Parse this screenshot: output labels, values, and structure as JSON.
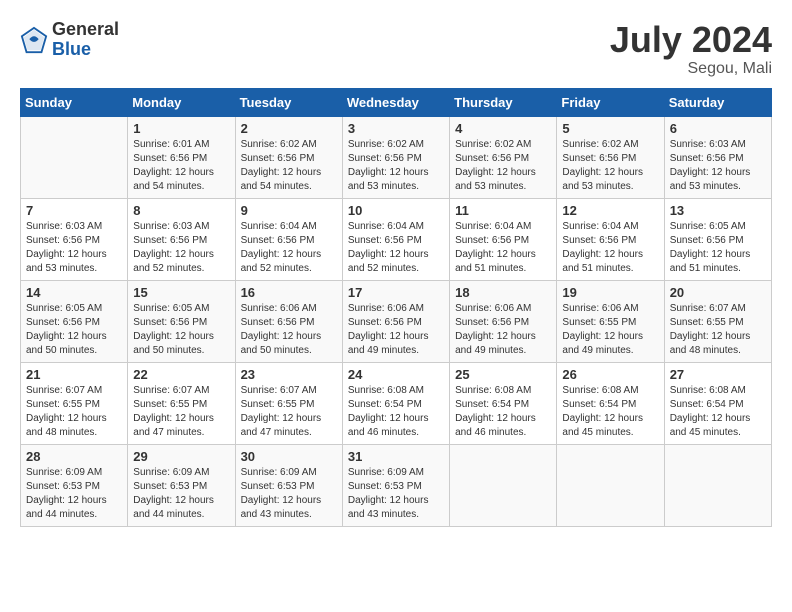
{
  "header": {
    "logo_general": "General",
    "logo_blue": "Blue",
    "month_year": "July 2024",
    "location": "Segou, Mali"
  },
  "columns": [
    "Sunday",
    "Monday",
    "Tuesday",
    "Wednesday",
    "Thursday",
    "Friday",
    "Saturday"
  ],
  "weeks": [
    [
      {
        "day": "",
        "info": ""
      },
      {
        "day": "1",
        "info": "Sunrise: 6:01 AM\nSunset: 6:56 PM\nDaylight: 12 hours\nand 54 minutes."
      },
      {
        "day": "2",
        "info": "Sunrise: 6:02 AM\nSunset: 6:56 PM\nDaylight: 12 hours\nand 54 minutes."
      },
      {
        "day": "3",
        "info": "Sunrise: 6:02 AM\nSunset: 6:56 PM\nDaylight: 12 hours\nand 53 minutes."
      },
      {
        "day": "4",
        "info": "Sunrise: 6:02 AM\nSunset: 6:56 PM\nDaylight: 12 hours\nand 53 minutes."
      },
      {
        "day": "5",
        "info": "Sunrise: 6:02 AM\nSunset: 6:56 PM\nDaylight: 12 hours\nand 53 minutes."
      },
      {
        "day": "6",
        "info": "Sunrise: 6:03 AM\nSunset: 6:56 PM\nDaylight: 12 hours\nand 53 minutes."
      }
    ],
    [
      {
        "day": "7",
        "info": "Sunrise: 6:03 AM\nSunset: 6:56 PM\nDaylight: 12 hours\nand 53 minutes."
      },
      {
        "day": "8",
        "info": "Sunrise: 6:03 AM\nSunset: 6:56 PM\nDaylight: 12 hours\nand 52 minutes."
      },
      {
        "day": "9",
        "info": "Sunrise: 6:04 AM\nSunset: 6:56 PM\nDaylight: 12 hours\nand 52 minutes."
      },
      {
        "day": "10",
        "info": "Sunrise: 6:04 AM\nSunset: 6:56 PM\nDaylight: 12 hours\nand 52 minutes."
      },
      {
        "day": "11",
        "info": "Sunrise: 6:04 AM\nSunset: 6:56 PM\nDaylight: 12 hours\nand 51 minutes."
      },
      {
        "day": "12",
        "info": "Sunrise: 6:04 AM\nSunset: 6:56 PM\nDaylight: 12 hours\nand 51 minutes."
      },
      {
        "day": "13",
        "info": "Sunrise: 6:05 AM\nSunset: 6:56 PM\nDaylight: 12 hours\nand 51 minutes."
      }
    ],
    [
      {
        "day": "14",
        "info": "Sunrise: 6:05 AM\nSunset: 6:56 PM\nDaylight: 12 hours\nand 50 minutes."
      },
      {
        "day": "15",
        "info": "Sunrise: 6:05 AM\nSunset: 6:56 PM\nDaylight: 12 hours\nand 50 minutes."
      },
      {
        "day": "16",
        "info": "Sunrise: 6:06 AM\nSunset: 6:56 PM\nDaylight: 12 hours\nand 50 minutes."
      },
      {
        "day": "17",
        "info": "Sunrise: 6:06 AM\nSunset: 6:56 PM\nDaylight: 12 hours\nand 49 minutes."
      },
      {
        "day": "18",
        "info": "Sunrise: 6:06 AM\nSunset: 6:56 PM\nDaylight: 12 hours\nand 49 minutes."
      },
      {
        "day": "19",
        "info": "Sunrise: 6:06 AM\nSunset: 6:55 PM\nDaylight: 12 hours\nand 49 minutes."
      },
      {
        "day": "20",
        "info": "Sunrise: 6:07 AM\nSunset: 6:55 PM\nDaylight: 12 hours\nand 48 minutes."
      }
    ],
    [
      {
        "day": "21",
        "info": "Sunrise: 6:07 AM\nSunset: 6:55 PM\nDaylight: 12 hours\nand 48 minutes."
      },
      {
        "day": "22",
        "info": "Sunrise: 6:07 AM\nSunset: 6:55 PM\nDaylight: 12 hours\nand 47 minutes."
      },
      {
        "day": "23",
        "info": "Sunrise: 6:07 AM\nSunset: 6:55 PM\nDaylight: 12 hours\nand 47 minutes."
      },
      {
        "day": "24",
        "info": "Sunrise: 6:08 AM\nSunset: 6:54 PM\nDaylight: 12 hours\nand 46 minutes."
      },
      {
        "day": "25",
        "info": "Sunrise: 6:08 AM\nSunset: 6:54 PM\nDaylight: 12 hours\nand 46 minutes."
      },
      {
        "day": "26",
        "info": "Sunrise: 6:08 AM\nSunset: 6:54 PM\nDaylight: 12 hours\nand 45 minutes."
      },
      {
        "day": "27",
        "info": "Sunrise: 6:08 AM\nSunset: 6:54 PM\nDaylight: 12 hours\nand 45 minutes."
      }
    ],
    [
      {
        "day": "28",
        "info": "Sunrise: 6:09 AM\nSunset: 6:53 PM\nDaylight: 12 hours\nand 44 minutes."
      },
      {
        "day": "29",
        "info": "Sunrise: 6:09 AM\nSunset: 6:53 PM\nDaylight: 12 hours\nand 44 minutes."
      },
      {
        "day": "30",
        "info": "Sunrise: 6:09 AM\nSunset: 6:53 PM\nDaylight: 12 hours\nand 43 minutes."
      },
      {
        "day": "31",
        "info": "Sunrise: 6:09 AM\nSunset: 6:53 PM\nDaylight: 12 hours\nand 43 minutes."
      },
      {
        "day": "",
        "info": ""
      },
      {
        "day": "",
        "info": ""
      },
      {
        "day": "",
        "info": ""
      }
    ]
  ]
}
